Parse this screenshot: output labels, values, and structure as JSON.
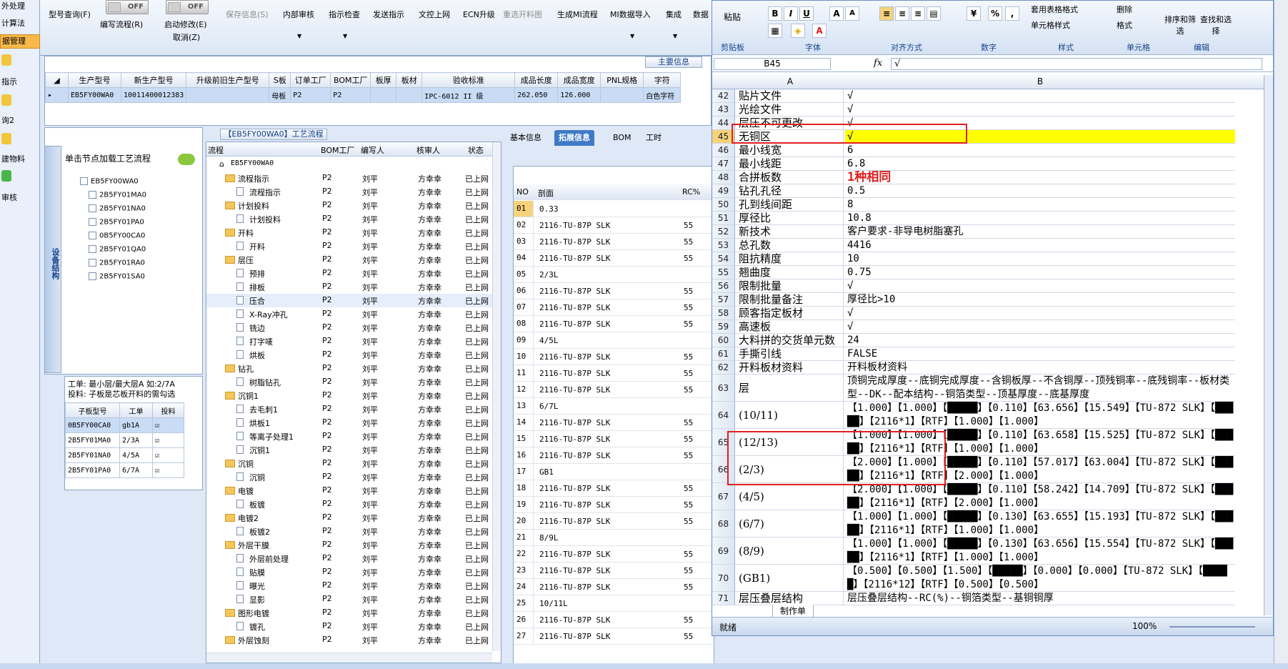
{
  "left_nav": [
    {
      "label": "外处理"
    },
    {
      "label": "计算法"
    },
    {
      "label": "据管理",
      "selected": true
    },
    {
      "label": "指示"
    },
    {
      "label": "询2"
    },
    {
      "label": "建物料"
    },
    {
      "label": "审核"
    }
  ],
  "toolbar": {
    "model_query": "型号查询(F)",
    "write_flow": "编写流程(R)",
    "toggle1": "OFF",
    "toggle2": "OFF",
    "enable_modify": "启动修改(E)",
    "cancel": "取消(Z)",
    "save_info": "保存信息(S)",
    "internal_review": "内部审核",
    "instruction_check": "指示检查",
    "send_instruction": "发送指示",
    "doc_upload": "文控上网",
    "ecn_upgrade": "ECN升级",
    "reopen_material": "重选开料图",
    "gen_mi": "生成MI流程",
    "mi_import": "MI数据导入",
    "integrate": "集成",
    "data": "数据"
  },
  "main_info": {
    "title": "主要信息",
    "headers": [
      "生产型号",
      "新生产型号",
      "升级前旧生产型号",
      "S板",
      "订单工厂",
      "BOM工厂",
      "板厚",
      "板材",
      "验收标准",
      "成品长度",
      "成品宽度",
      "PNL规格",
      "字符"
    ],
    "row": [
      "EB5FY00WA0",
      "10011400012383",
      "",
      "母板",
      "P2",
      "P2",
      "",
      "",
      "IPC-6012 II 级",
      "262.050",
      "126.000",
      "",
      "白色字符"
    ]
  },
  "tree_panel": {
    "vtab": "设备结构",
    "prompt": "单击节点加载工艺流程",
    "nodes": [
      "EB5FY00WA0",
      "2B5FY01MA0",
      "2B5FY01NA0",
      "2B5FY01PA0",
      "0B5FY00CA0",
      "2B5FY01QA0",
      "2B5FY01RA0",
      "2B5FY01SA0"
    ]
  },
  "sub_panel": {
    "note1": "工单: 最小层/最大层A 如:2/7A",
    "note2": "投料: 子板是芯板开料的需勾选",
    "headers": [
      "子板型号",
      "工单",
      "投料"
    ],
    "rows": [
      [
        "0B5FY00CA0",
        "gb1A"
      ],
      [
        "2B5FY01MA0",
        "2/3A"
      ],
      [
        "2B5FY01NA0",
        "4/5A"
      ],
      [
        "2B5FY01PA0",
        "6/7A"
      ]
    ]
  },
  "flow_panel": {
    "title": "【EB5FY00WA0】工艺流程",
    "headers": [
      "流程",
      "BOM工厂",
      "编写人",
      "核审人",
      "状态"
    ],
    "root": "EB5FY00WA0",
    "factory": "P2",
    "writer": "刘平",
    "reviewer": "方幸幸",
    "status": "已上网",
    "rows": [
      {
        "name": "流程指示",
        "folder": true
      },
      {
        "name": "流程指示"
      },
      {
        "name": "计划投料",
        "folder": true
      },
      {
        "name": "计划投料"
      },
      {
        "name": "开料",
        "folder": true
      },
      {
        "name": "开料"
      },
      {
        "name": "层压",
        "folder": true
      },
      {
        "name": "预排"
      },
      {
        "name": "排板"
      },
      {
        "name": "压合"
      },
      {
        "name": "X-Ray冲孔"
      },
      {
        "name": "铣边"
      },
      {
        "name": "打字唛"
      },
      {
        "name": "烘板"
      },
      {
        "name": "钻孔",
        "folder": true
      },
      {
        "name": "树脂钻孔"
      },
      {
        "name": "沉铜1",
        "folder": true
      },
      {
        "name": "去毛刺1"
      },
      {
        "name": "烘板1"
      },
      {
        "name": "等离子处理1"
      },
      {
        "name": "沉铜1"
      },
      {
        "name": "沉铜",
        "folder": true
      },
      {
        "name": "沉铜"
      },
      {
        "name": "电镀",
        "folder": true
      },
      {
        "name": "板镀"
      },
      {
        "name": "电镀2",
        "folder": true
      },
      {
        "name": "板镀2"
      },
      {
        "name": "外层干膜",
        "folder": true
      },
      {
        "name": "外层前处理"
      },
      {
        "name": "贴膜"
      },
      {
        "name": "曝光"
      },
      {
        "name": "显影"
      },
      {
        "name": "图形电镀",
        "folder": true
      },
      {
        "name": "镀孔"
      },
      {
        "name": "外层蚀刻",
        "folder": true
      }
    ]
  },
  "tabs": [
    "基本信息",
    "拓展信息",
    "BOM",
    "工时"
  ],
  "ext_panel": {
    "headers": [
      "NO",
      "剖面",
      "RC%"
    ],
    "rows": [
      [
        "01",
        "0.33",
        ""
      ],
      [
        "02",
        "2116-TU-87P SLK",
        "55"
      ],
      [
        "03",
        "2116-TU-87P SLK",
        "55"
      ],
      [
        "04",
        "2116-TU-87P SLK",
        "55"
      ],
      [
        "05",
        "2/3L",
        ""
      ],
      [
        "06",
        "2116-TU-87P SLK",
        "55"
      ],
      [
        "07",
        "2116-TU-87P SLK",
        "55"
      ],
      [
        "08",
        "2116-TU-87P SLK",
        "55"
      ],
      [
        "09",
        "4/5L",
        ""
      ],
      [
        "10",
        "2116-TU-87P SLK",
        "55"
      ],
      [
        "11",
        "2116-TU-87P SLK",
        "55"
      ],
      [
        "12",
        "2116-TU-87P SLK",
        "55"
      ],
      [
        "13",
        "6/7L",
        ""
      ],
      [
        "14",
        "2116-TU-87P SLK",
        "55"
      ],
      [
        "15",
        "2116-TU-87P SLK",
        "55"
      ],
      [
        "16",
        "2116-TU-87P SLK",
        "55"
      ],
      [
        "17",
        "GB1",
        ""
      ],
      [
        "18",
        "2116-TU-87P SLK",
        "55"
      ],
      [
        "19",
        "2116-TU-87P SLK",
        "55"
      ],
      [
        "20",
        "2116-TU-87P SLK",
        "55"
      ],
      [
        "21",
        "8/9L",
        ""
      ],
      [
        "22",
        "2116-TU-87P SLK",
        "55"
      ],
      [
        "23",
        "2116-TU-87P SLK",
        "55"
      ],
      [
        "24",
        "2116-TU-87P SLK",
        "55"
      ],
      [
        "25",
        "10/11L",
        ""
      ],
      [
        "26",
        "2116-TU-87P SLK",
        "55"
      ],
      [
        "27",
        "2116-TU-87P SLK",
        "55"
      ]
    ]
  },
  "excel": {
    "ribbon": {
      "paste": "粘贴",
      "clipboard": "剪贴板",
      "font": "字体",
      "alignment": "对齐方式",
      "number": "数字",
      "styles": "样式",
      "cells": "单元格",
      "editing": "编辑",
      "table_format": "套用表格格式",
      "cell_styles": "单元格样式",
      "delete": "删除",
      "format": "格式",
      "sort_filter": "排序和筛选",
      "find_select": "查找和选择"
    },
    "name_box": "B45",
    "formula": "√",
    "col_a": "A",
    "col_b": "B",
    "rows": [
      {
        "n": "42",
        "a": "贴片文件",
        "b": "√"
      },
      {
        "n": "43",
        "a": "光绘文件",
        "b": "√"
      },
      {
        "n": "44",
        "a": "层压不可更改",
        "b": "√"
      },
      {
        "n": "45",
        "a": "无铜区",
        "b": "√",
        "selected": true
      },
      {
        "n": "46",
        "a": "最小线宽",
        "b": "6"
      },
      {
        "n": "47",
        "a": "最小线距",
        "b": "6.8"
      },
      {
        "n": "48",
        "a": "合拼板数",
        "b": "1种相同",
        "red": true
      },
      {
        "n": "49",
        "a": "钻孔孔径",
        "b": "0.5"
      },
      {
        "n": "50",
        "a": "孔到线间距",
        "b": "8"
      },
      {
        "n": "51",
        "a": "厚径比",
        "b": "10.8"
      },
      {
        "n": "52",
        "a": "新技术",
        "b": "客户要求-非导电树脂塞孔"
      },
      {
        "n": "53",
        "a": "总孔数",
        "b": "4416"
      },
      {
        "n": "54",
        "a": "阻抗精度",
        "b": "10"
      },
      {
        "n": "55",
        "a": "翘曲度",
        "b": "0.75"
      },
      {
        "n": "56",
        "a": "限制批量",
        "b": "√"
      },
      {
        "n": "57",
        "a": "限制批量备注",
        "b": "厚径比>10"
      },
      {
        "n": "58",
        "a": "顾客指定板材",
        "b": "√"
      },
      {
        "n": "59",
        "a": "高速板",
        "b": "√"
      },
      {
        "n": "60",
        "a": "大料拼的交货单元数",
        "b": "24"
      },
      {
        "n": "61",
        "a": "手撕引线",
        "b": "FALSE"
      },
      {
        "n": "62",
        "a": "开料板材资料",
        "b": "开料板材资料"
      },
      {
        "n": "63",
        "a": "层",
        "b": "顶铜完成厚度--底铜完成厚度--含铜板厚--不含铜厚--顶残铜率--底残铜率--板材类型--DK--配本结构--铜箔类型--顶基厚度--底基厚度",
        "tall": true
      },
      {
        "n": "64",
        "a": "(10/11)",
        "b": "【1.000】【1.000】【█████】【0.110】【63.656】【15.549】【TU-872 SLK】【█████】【2116*1】【RTF】【1.000】【1.000】",
        "tall": true
      },
      {
        "n": "65",
        "a": "(12/13)",
        "b": "【1.000】【1.000】【█████】【0.110】【63.658】【15.525】【TU-872 SLK】【█████】【2116*1】【RTF】【1.000】【1.000】",
        "tall": true
      },
      {
        "n": "66",
        "a": "(2/3)",
        "b": "【2.000】【1.000】【█████】【0.110】【57.017】【63.004】【TU-872 SLK】【█████】【2116*1】【RTF】【2.000】【1.000】",
        "tall": true
      },
      {
        "n": "67",
        "a": "(4/5)",
        "b": "【2.000】【1.000】【█████】【0.110】【58.242】【14.709】【TU-872 SLK】【█████】【2116*1】【RTF】【2.000】【1.000】",
        "tall": true
      },
      {
        "n": "68",
        "a": "(6/7)",
        "b": "【1.000】【1.000】【█████】【0.130】【63.655】【15.193】【TU-872 SLK】【█████】【2116*1】【RTF】【1.000】【1.000】",
        "tall": true
      },
      {
        "n": "69",
        "a": "(8/9)",
        "b": "【1.000】【1.000】【█████】【0.130】【63.656】【15.554】【TU-872 SLK】【█████】【2116*1】【RTF】【1.000】【1.000】",
        "tall": true
      },
      {
        "n": "70",
        "a": "(GB1)",
        "b": "【0.500】【0.500】【1.500】【█████】【0.000】【0.000】【TU-872 SLK】【█████】【2116*12】【RTF】【0.500】【0.500】",
        "tall": true
      },
      {
        "n": "71",
        "a": "层压叠层结构",
        "b": "层压叠层结构--RC(%)--铜箔类型--基铜铜厚"
      }
    ],
    "sheet_tab": "制作单",
    "status_ready": "就绪",
    "zoom": "100%",
    "accent": "#ffff00",
    "highlight": "#e02020"
  }
}
